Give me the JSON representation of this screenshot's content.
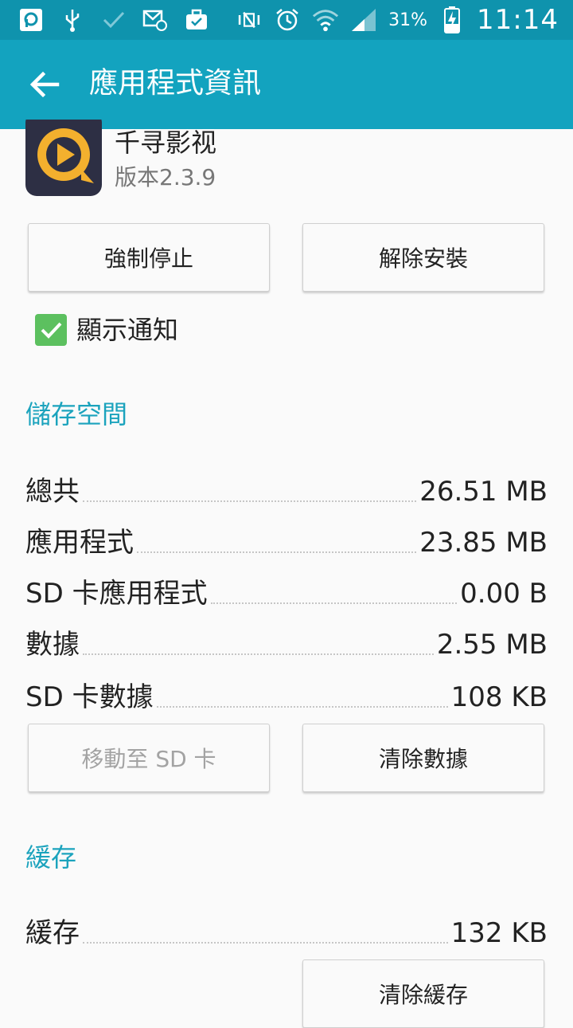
{
  "status_bar": {
    "battery_percent": "31%",
    "time": "11:14",
    "left_icons": [
      "app-notification-icon",
      "usb-icon",
      "check-icon",
      "email-icon",
      "briefcase-icon"
    ],
    "right_icons": [
      "mute-vibrate-icon",
      "alarm-icon",
      "wifi-icon",
      "signal-icon",
      "battery-charging-icon"
    ]
  },
  "app_bar": {
    "title": "應用程式資訊"
  },
  "app": {
    "name": "千寻影视",
    "version": "版本2.3.9"
  },
  "actions": {
    "force_stop": "強制停止",
    "uninstall": "解除安裝"
  },
  "notification": {
    "label": "顯示通知",
    "checked": true
  },
  "storage": {
    "header": "儲存空間",
    "rows": [
      {
        "label": "總共",
        "value": "26.51 MB"
      },
      {
        "label": "應用程式",
        "value": "23.85 MB"
      },
      {
        "label": "SD 卡應用程式",
        "value": "0.00 B"
      },
      {
        "label": "數據",
        "value": "2.55 MB"
      },
      {
        "label": "SD 卡數據",
        "value": "108 KB"
      }
    ],
    "move_to_sd": "移動至 SD 卡",
    "clear_data": "清除數據"
  },
  "cache": {
    "header": "緩存",
    "rows": [
      {
        "label": "緩存",
        "value": "132 KB"
      }
    ],
    "clear_cache": "清除緩存"
  },
  "colors": {
    "status_bar": "#0f93ad",
    "app_bar": "#13a3bf",
    "accent": "#1ba3bd",
    "checkbox": "#5cc05f"
  }
}
